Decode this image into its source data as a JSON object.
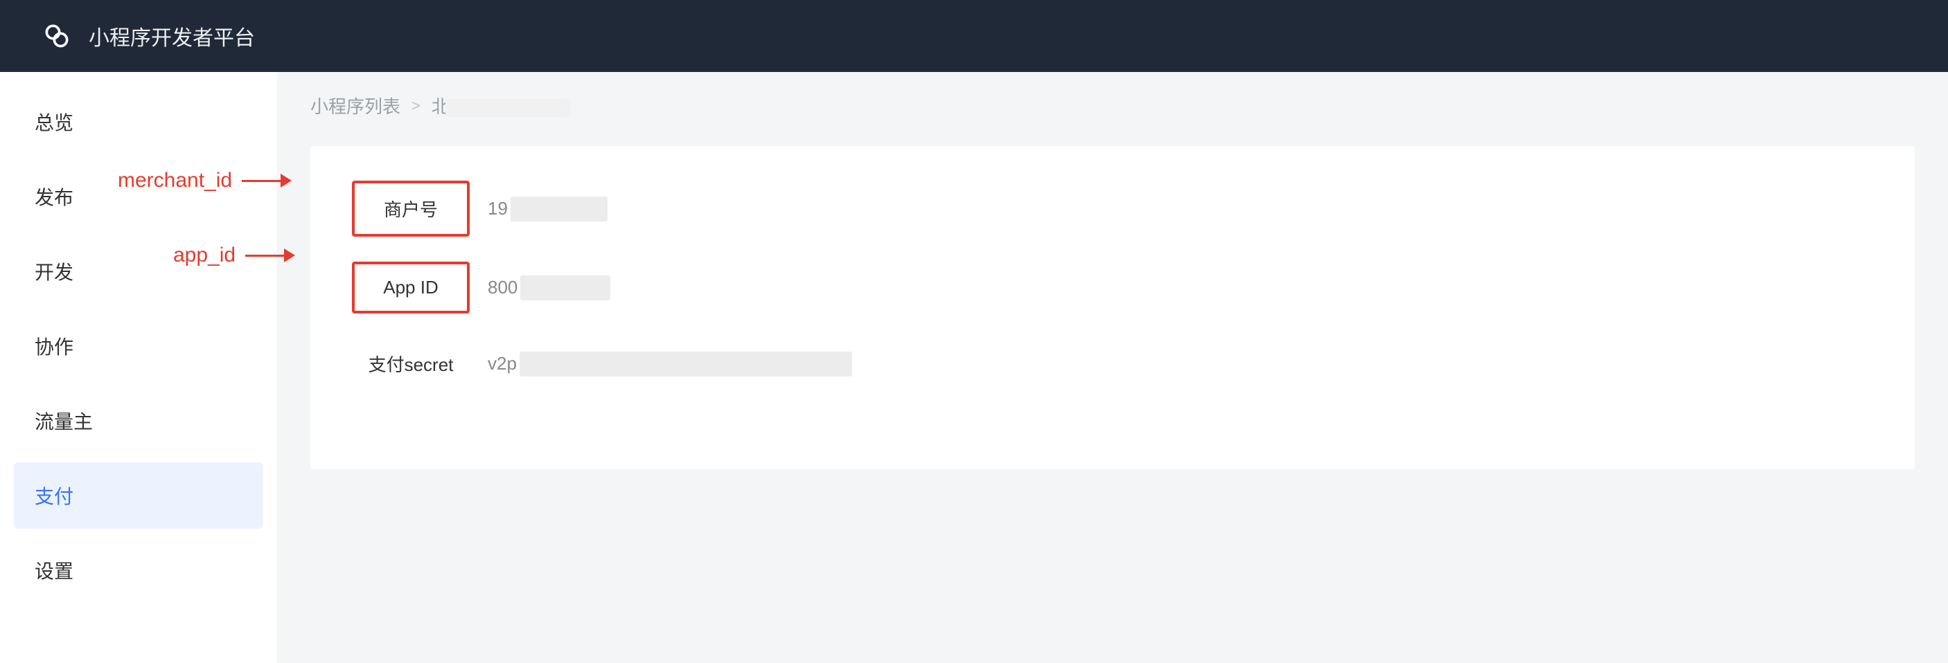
{
  "header": {
    "title": "小程序开发者平台"
  },
  "sidebar": {
    "items": [
      {
        "label": "总览",
        "active": false
      },
      {
        "label": "发布",
        "active": false
      },
      {
        "label": "开发",
        "active": false
      },
      {
        "label": "协作",
        "active": false
      },
      {
        "label": "流量主",
        "active": false
      },
      {
        "label": "支付",
        "active": true
      },
      {
        "label": "设置",
        "active": false
      }
    ]
  },
  "breadcrumb": {
    "root": "小程序列表",
    "separator": ">",
    "current_prefix": "北"
  },
  "form": {
    "merchant": {
      "label": "商户号",
      "value_prefix": "19"
    },
    "app": {
      "label": "App ID",
      "value_prefix": "800"
    },
    "secret": {
      "label": "支付secret",
      "value_prefix": "v2p"
    }
  },
  "annotations": {
    "merchant": "merchant_id",
    "app": "app_id"
  }
}
